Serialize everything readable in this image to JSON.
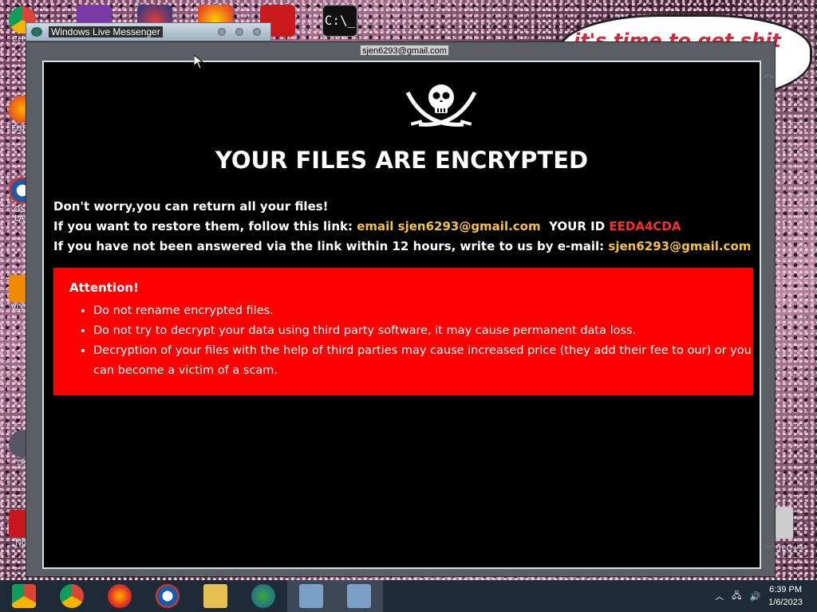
{
  "desktop": {
    "icons": [
      {
        "label": "CH\nD"
      },
      {
        "label": "FURR"
      },
      {
        "label": "OSA\nLAD"
      },
      {
        "label": "VLC\nP"
      },
      {
        "label": "Do"
      },
      {
        "label": "Not"
      }
    ],
    "bubble_text": "it's time to get shit"
  },
  "messenger": {
    "title": "Windows Live Messenger",
    "contact": "sjen6293@gmail.com"
  },
  "ransom": {
    "headline": "YOUR FILES ARE ENCRYPTED",
    "line1": "Don't worry,you can return all your files!",
    "line2_prefix": "If you want to restore them, follow this link:",
    "line2_email": "email sjen6293@gmail.com",
    "line2_id_label": "YOUR ID",
    "line2_id": "EEDA4CDA",
    "line3_prefix": "If you have not been answered via the link within 12 hours, write to us by e-mail:",
    "line3_email": "sjen6293@gmail.com",
    "attention_title": "Attention!",
    "bullets": [
      "Do not rename encrypted files.",
      "Do not try to decrypt your data using third party software, it may cause permanent data loss.",
      "Decryption of your files with the help of third parties may cause increased price (they add their fee to our) or you can become a victim of a scam."
    ]
  },
  "taskbar": {
    "time": "6:39 PM",
    "date": "1/6/2023"
  },
  "right_edge_label": "n C++"
}
